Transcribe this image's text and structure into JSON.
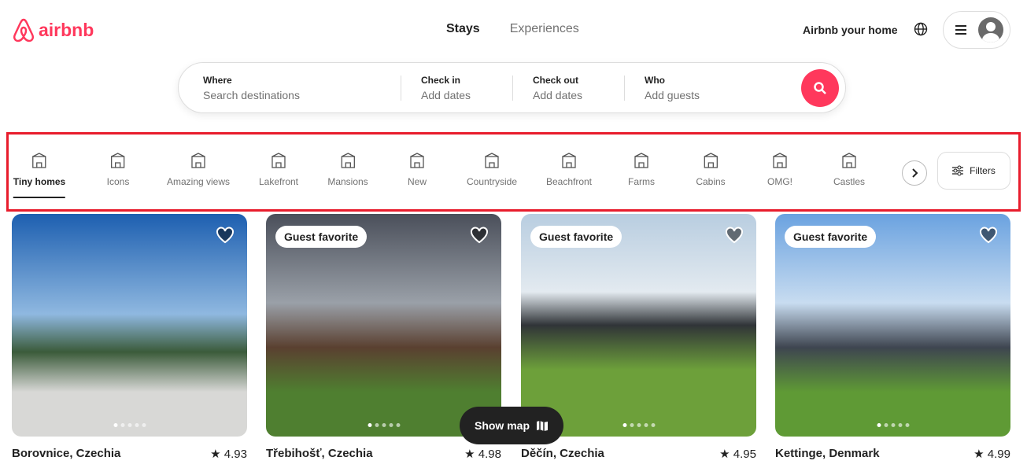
{
  "brand": {
    "name": "airbnb",
    "color": "#ff385c"
  },
  "nav": {
    "stays": "Stays",
    "experiences": "Experiences"
  },
  "header": {
    "host": "Airbnb your home"
  },
  "search": [
    {
      "label": "Where",
      "placeholder": "Search destinations"
    },
    {
      "label": "Check in",
      "placeholder": "Add dates"
    },
    {
      "label": "Check out",
      "placeholder": "Add dates"
    },
    {
      "label": "Who",
      "placeholder": "Add guests"
    }
  ],
  "categories": [
    "Tiny homes",
    "Icons",
    "Amazing views",
    "Lakefront",
    "Mansions",
    "New",
    "Countryside",
    "Beachfront",
    "Farms",
    "Cabins",
    "OMG!",
    "Castles"
  ],
  "filters": "Filters",
  "listings": [
    {
      "title": "Borovnice, Czechia",
      "rating": "4.93",
      "badge": ""
    },
    {
      "title": "Třebihošť, Czechia",
      "rating": "4.98",
      "badge": "Guest favorite"
    },
    {
      "title": "Děčín, Czechia",
      "rating": "4.95",
      "badge": "Guest favorite"
    },
    {
      "title": "Kettinge, Denmark",
      "rating": "4.99",
      "badge": "Guest favorite"
    }
  ],
  "show_map": "Show map"
}
